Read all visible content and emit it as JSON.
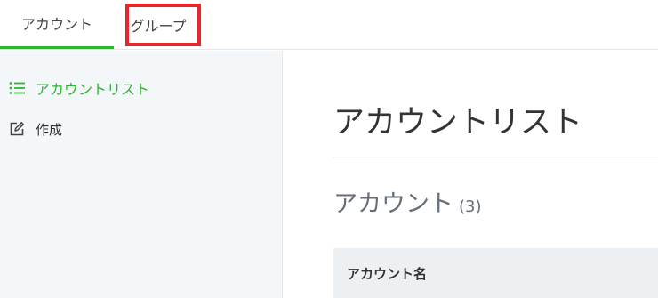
{
  "tabs": [
    {
      "label": "アカウント",
      "active": true
    },
    {
      "label": "グループ",
      "active": false,
      "highlighted": true
    }
  ],
  "sidebar": {
    "items": [
      {
        "label": "アカウントリスト",
        "icon": "list-icon",
        "active": true
      },
      {
        "label": "作成",
        "icon": "edit-icon",
        "active": false
      }
    ]
  },
  "main": {
    "title": "アカウントリスト",
    "section_title": "アカウント",
    "section_count": "(3)",
    "table": {
      "columns": [
        "アカウント名"
      ]
    }
  },
  "colors": {
    "accent_green": "#2fb52f",
    "highlight_red": "#e8252a",
    "sidebar_bg": "#f4f7fa",
    "table_header_bg": "#edf0f3"
  }
}
